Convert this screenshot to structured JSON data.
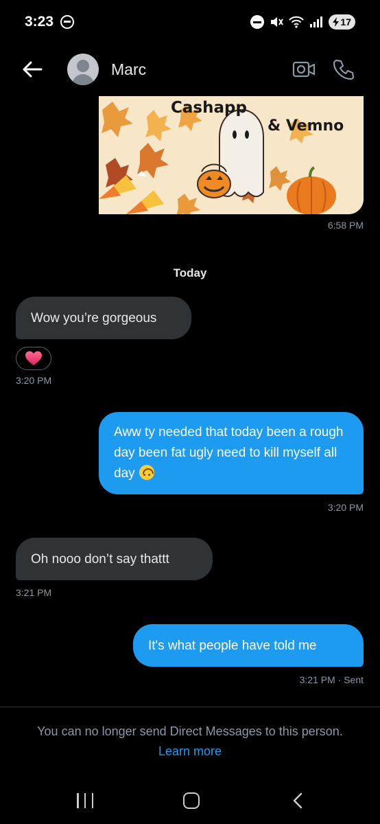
{
  "status_bar": {
    "time": "3:23",
    "battery": "17",
    "icons": [
      "app-notification-icon",
      "do-not-disturb-icon",
      "mute-icon",
      "wifi-icon",
      "signal-icon",
      "battery-charging-icon"
    ]
  },
  "header": {
    "contact_name": "Marc",
    "icons": [
      "back-arrow-icon",
      "avatar",
      "video-call-icon",
      "phone-call-icon"
    ]
  },
  "image_message": {
    "text_line1": "Cashapp",
    "text_line2": "& Vemno",
    "timestamp": "6:58 PM"
  },
  "day_separator": "Today",
  "messages": [
    {
      "direction": "incoming",
      "text": "Wow you’re gorgeous",
      "reaction": "heart-emoji",
      "timestamp": "3:20 PM"
    },
    {
      "direction": "outgoing",
      "text": "Aww ty needed that today been a rough day been fat ugly need to kill myself all day",
      "emoji": "upside-down-face-emoji",
      "timestamp": "3:20 PM"
    },
    {
      "direction": "incoming",
      "text": "Oh nooo don’t say thattt",
      "timestamp": "3:21 PM"
    },
    {
      "direction": "outgoing",
      "text": "It's what people  have told me",
      "timestamp": "3:21 PM · Sent"
    }
  ],
  "footer": {
    "notice": "You can no longer send Direct Messages to this person.",
    "learn_more": "Learn more"
  },
  "colors": {
    "background": "#000000",
    "incoming_bubble": "#2f3336",
    "outgoing_bubble": "#1d9bf0",
    "link": "#1d9bf0",
    "secondary_text": "#8b98a5"
  }
}
